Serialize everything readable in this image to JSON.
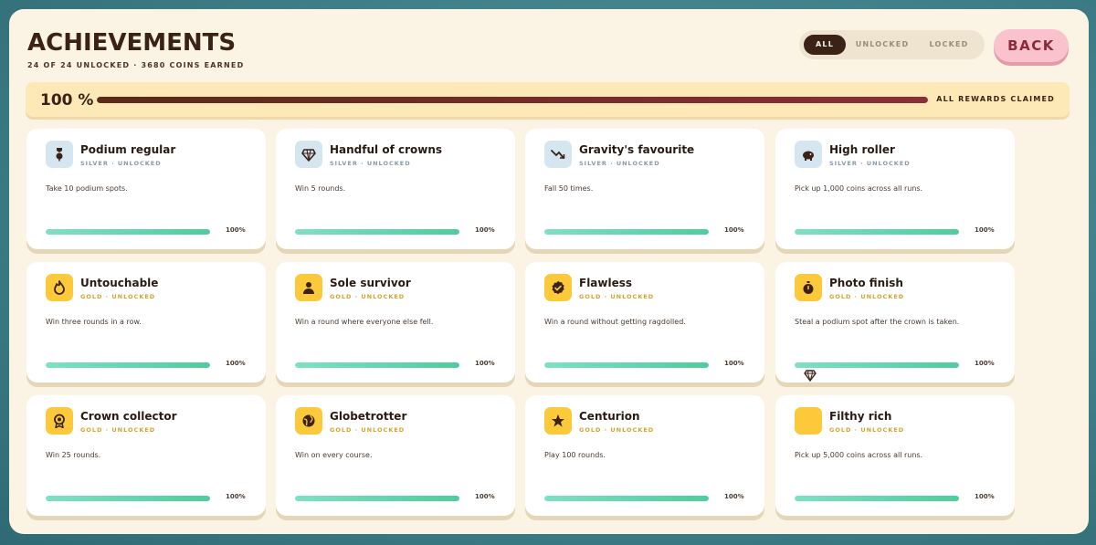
{
  "header": {
    "title": "ACHIEVEMENTS",
    "subtitle": "24 OF 24 UNLOCKED · 3680 COINS EARNED"
  },
  "filters": [
    {
      "label": "ALL",
      "active": true
    },
    {
      "label": "UNLOCKED",
      "active": false
    },
    {
      "label": "LOCKED",
      "active": false
    }
  ],
  "back_label": "BACK",
  "overall": {
    "percent_label": "100 %",
    "progress": 1.0,
    "status": "ALL REWARDS CLAIMED"
  },
  "colors": {
    "silver_badge": "#d6e6f0",
    "silver_text": "#8a9aa6",
    "gold_badge": "#fcc93a",
    "gold_text": "#d8a22a",
    "icon_dark": "#3a2216"
  },
  "achievements": [
    {
      "name": "Podium regular",
      "tier": "SILVER · UNLOCKED",
      "tier_kind": "silver",
      "desc": "Take 10 podium spots.",
      "progress": 1.0,
      "pct_label": "100%",
      "icon": "medal-icon"
    },
    {
      "name": "Handful of crowns",
      "tier": "SILVER · UNLOCKED",
      "tier_kind": "silver",
      "desc": "Win 5 rounds.",
      "progress": 1.0,
      "pct_label": "100%",
      "icon": "gem-icon"
    },
    {
      "name": "Gravity's favourite",
      "tier": "SILVER · UNLOCKED",
      "tier_kind": "silver",
      "desc": "Fall 50 times.",
      "progress": 1.0,
      "pct_label": "100%",
      "icon": "trend-down-icon"
    },
    {
      "name": "High roller",
      "tier": "SILVER · UNLOCKED",
      "tier_kind": "silver",
      "desc": "Pick up 1,000 coins across all runs.",
      "progress": 1.0,
      "pct_label": "100%",
      "icon": "piggy-bank-icon"
    },
    {
      "name": "Untouchable",
      "tier": "GOLD · UNLOCKED",
      "tier_kind": "gold",
      "desc": "Win three rounds in a row.",
      "progress": 1.0,
      "pct_label": "100%",
      "icon": "flame-icon"
    },
    {
      "name": "Sole survivor",
      "tier": "GOLD · UNLOCKED",
      "tier_kind": "gold",
      "desc": "Win a round where everyone else fell.",
      "progress": 1.0,
      "pct_label": "100%",
      "icon": "person-icon"
    },
    {
      "name": "Flawless",
      "tier": "GOLD · UNLOCKED",
      "tier_kind": "gold",
      "desc": "Win a round without getting ragdolled.",
      "progress": 1.0,
      "pct_label": "100%",
      "icon": "verified-check-icon"
    },
    {
      "name": "Photo finish",
      "tier": "GOLD · UNLOCKED",
      "tier_kind": "gold",
      "desc": "Steal a podium spot after the crown is taken.",
      "progress": 1.0,
      "pct_label": "100%",
      "icon": "stopwatch-icon"
    },
    {
      "name": "Crown collector",
      "tier": "GOLD · UNLOCKED",
      "tier_kind": "gold",
      "desc": "Win 25 rounds.",
      "progress": 1.0,
      "pct_label": "100%",
      "icon": "ribbon-award-icon"
    },
    {
      "name": "Globetrotter",
      "tier": "GOLD · UNLOCKED",
      "tier_kind": "gold",
      "desc": "Win on every course.",
      "progress": 1.0,
      "pct_label": "100%",
      "icon": "globe-icon"
    },
    {
      "name": "Centurion",
      "tier": "GOLD · UNLOCKED",
      "tier_kind": "gold",
      "desc": "Play 100 rounds.",
      "progress": 1.0,
      "pct_label": "100%",
      "icon": "star-icon"
    },
    {
      "name": "Filthy rich",
      "tier": "GOLD · UNLOCKED",
      "tier_kind": "gold",
      "desc": "Pick up 5,000 coins across all runs.",
      "progress": 1.0,
      "pct_label": "100%",
      "icon": "blank-badge-icon"
    }
  ]
}
